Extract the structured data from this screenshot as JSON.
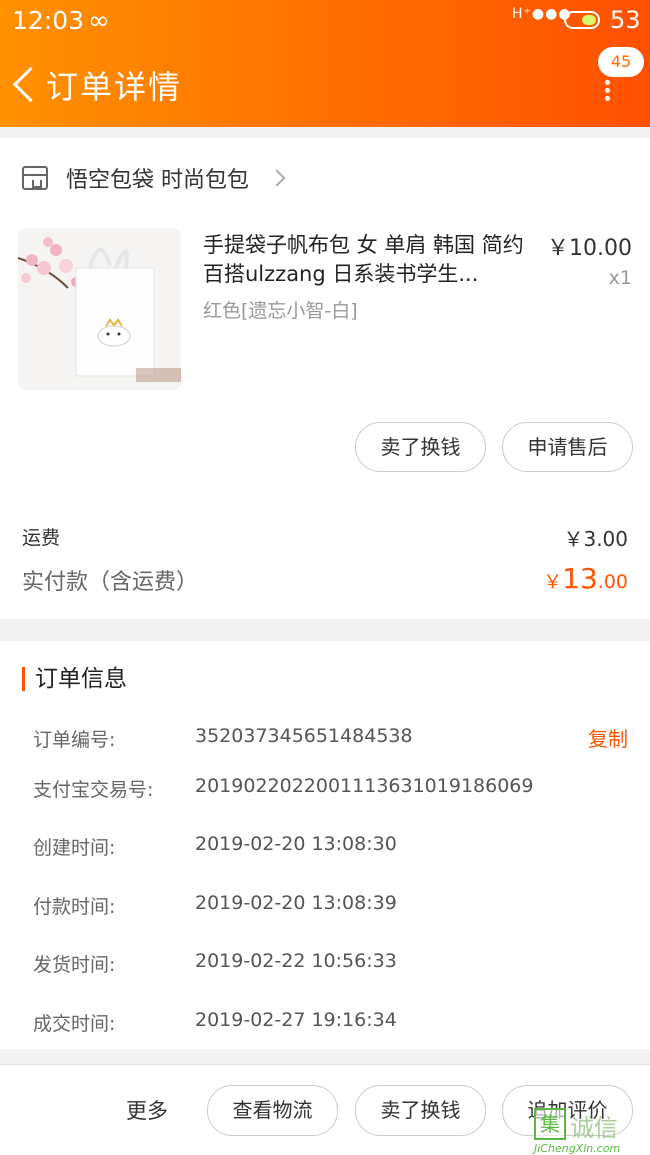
{
  "status_bar": {
    "time": "12:03",
    "loop_icon": "∞",
    "signal": "H⁺●●●",
    "battery": "53"
  },
  "nav": {
    "title": "订单详情",
    "badge_count": "45"
  },
  "shop": {
    "name": "悟空包袋 时尚包包"
  },
  "product": {
    "title": "手提袋子帆布包 女 单肩 韩国 简约百搭ulzzang 日系装书学生...",
    "price": "￥10.00",
    "quantity": "x1",
    "sku": "红色[遗忘小智-白]"
  },
  "item_actions": {
    "sell": "卖了换钱",
    "after_sale": "申请售后"
  },
  "fees": {
    "shipping_label": "运费",
    "shipping_value": "￥3.00",
    "paid_label": "实付款（含运费）",
    "paid_currency": "￥",
    "paid_integer": "13",
    "paid_decimal": ".00"
  },
  "order_info": {
    "title": "订单信息",
    "copy_label": "复制",
    "rows": [
      {
        "label": "订单编号:",
        "value": "352037345651484538"
      },
      {
        "label": "支付宝交易号:",
        "value": "2019022022001113631019186069"
      },
      {
        "label": "创建时间:",
        "value": "2019-02-20 13:08:30"
      },
      {
        "label": "付款时间:",
        "value": "2019-02-20 13:08:39"
      },
      {
        "label": "发货时间:",
        "value": "2019-02-22 10:56:33"
      },
      {
        "label": "成交时间:",
        "value": "2019-02-27 19:16:34"
      }
    ]
  },
  "bottom_bar": {
    "more": "更多",
    "logistics": "查看物流",
    "sell": "卖了换钱",
    "review": "追加评价"
  },
  "watermark": {
    "box": "集",
    "text": "诚信",
    "url": "JiChengXin.com"
  }
}
